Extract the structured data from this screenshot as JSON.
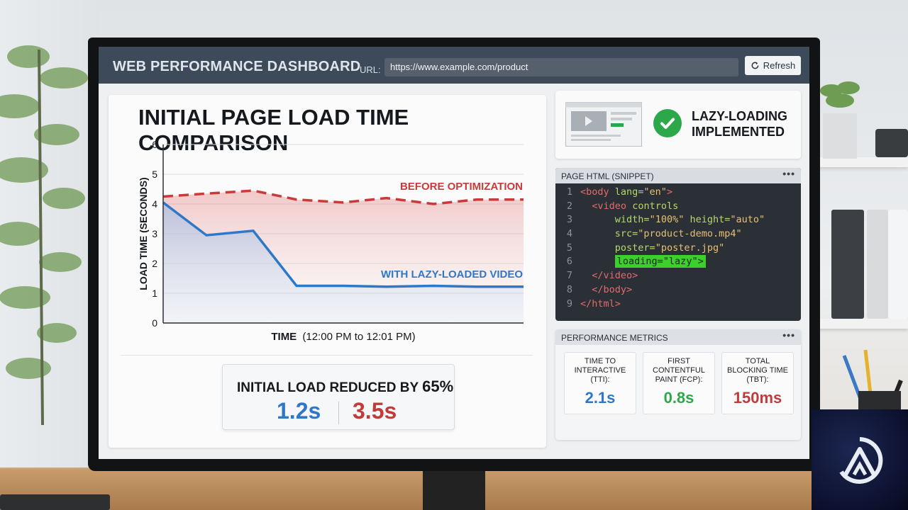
{
  "app": {
    "title": "WEB PERFORMANCE DASHBOARD",
    "url_label": "URL:",
    "url_value": "https://www.example.com/product",
    "refresh_label": "Refresh"
  },
  "chart": {
    "title": "INITIAL PAGE LOAD TIME COMPARISON",
    "ylabel": "LOAD TIME (SECONDS)",
    "xlabel_main": "TIME",
    "xlabel_sub": "(12:00 PM to 12:01 PM)"
  },
  "chart_data": {
    "type": "line",
    "title": "INITIAL PAGE LOAD TIME COMPARISON",
    "xlabel": "TIME (12:00 PM to 12:01 PM)",
    "ylabel": "LOAD TIME (SECONDS)",
    "ylim": [
      0,
      6
    ],
    "yticks": [
      0,
      1,
      2,
      3,
      4,
      5,
      6
    ],
    "grid": true,
    "x": [
      0,
      0.12,
      0.25,
      0.37,
      0.5,
      0.62,
      0.75,
      0.87,
      1.0
    ],
    "series": [
      {
        "name": "BEFORE OPTIMIZATION",
        "style": "dashed",
        "color": "#c93a3a",
        "values": [
          4.25,
          4.35,
          4.45,
          4.15,
          4.05,
          4.2,
          4.0,
          4.15,
          4.15
        ]
      },
      {
        "name": "WITH LAZY-LOADED VIDEO",
        "style": "solid",
        "color": "#2f78c8",
        "values": [
          4.05,
          2.95,
          3.1,
          1.25,
          1.25,
          1.22,
          1.25,
          1.22,
          1.22
        ]
      }
    ]
  },
  "summary": {
    "label": "INITIAL LOAD REDUCED BY",
    "percent": "65%",
    "new_value": "1.2s",
    "old_value": "3.5s"
  },
  "lazy": {
    "line1": "LAZY-LOADING",
    "line2": "IMPLEMENTED"
  },
  "code": {
    "header": "PAGE HTML (SNIPPET)",
    "more": "•••"
  },
  "metrics": {
    "header": "PERFORMANCE METRICS",
    "more": "•••",
    "items": [
      {
        "label": "TIME TO INTERACTIVE (TTI):",
        "value": "2.1s",
        "color": "#2f78c8"
      },
      {
        "label": "FIRST CONTENTFUL PAINT (FCP):",
        "value": "0.8s",
        "color": "#2ca84a"
      },
      {
        "label": "TOTAL BLOCKING TIME (TBT):",
        "value": "150ms",
        "color": "#c13b3b"
      }
    ]
  },
  "colors": {
    "topbar": "#3d4a5a",
    "before": "#c93a3a",
    "after": "#2f78c8",
    "success": "#2ca84a"
  }
}
